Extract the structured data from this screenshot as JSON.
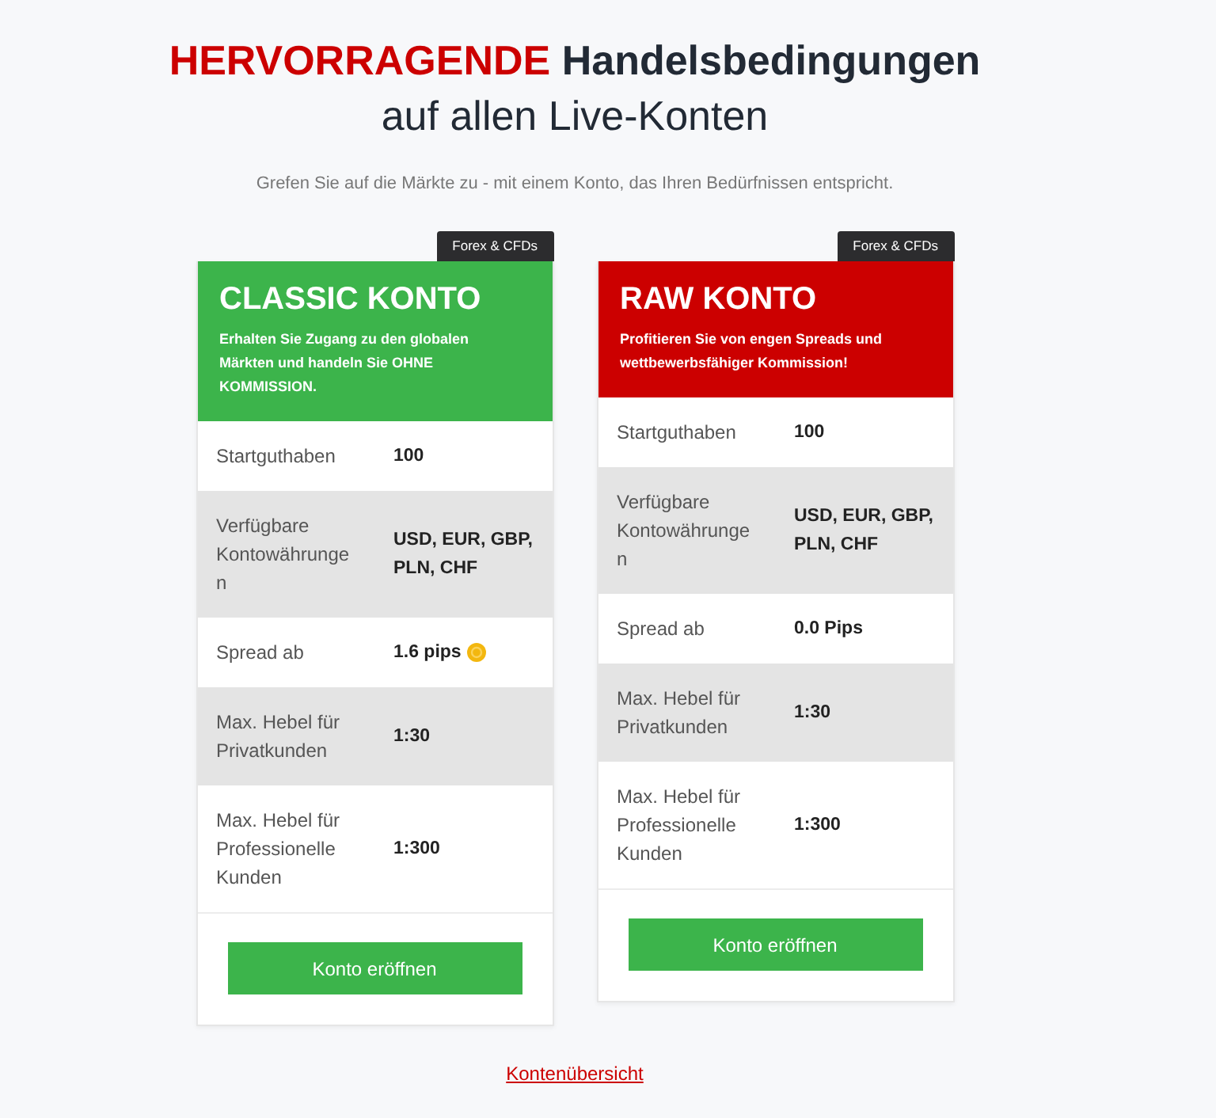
{
  "heading": {
    "highlight": "HERVORRAGENDE",
    "text": "Handelsbedingungen",
    "subline": "auf allen Live-Konten"
  },
  "intro": "Grefen Sie auf die Märkte zu - mit einem Konto, das Ihren Bedürfnissen entspricht.",
  "cards": [
    {
      "tag": "Forex & CFDs",
      "title": "CLASSIC KONTO",
      "color": "#3cb44b",
      "description": "Erhalten Sie Zugang zu den globalen Märkten und handeln Sie OHNE KOMMISSION.",
      "rows": [
        {
          "label": "Startguthaben",
          "value": "100",
          "note": false
        },
        {
          "label": "Verfügbare Kontowährungen",
          "value": "USD, EUR, GBP, PLN, CHF",
          "note": false
        },
        {
          "label": "Spread ab",
          "value": "1.6 pips",
          "note": true
        },
        {
          "label": "Max. Hebel für Privatkunden",
          "value": "1:30",
          "note": false
        },
        {
          "label": "Max. Hebel für Professionelle Kunden",
          "value": "1:300",
          "note": false
        }
      ],
      "button": "Konto eröffnen"
    },
    {
      "tag": "Forex & CFDs",
      "title": "RAW KONTO",
      "color": "#cc0000",
      "description": "Profitieren Sie von engen Spreads und wettbewerbsfähiger Kommission!",
      "rows": [
        {
          "label": "Startguthaben",
          "value": "100",
          "note": false
        },
        {
          "label": "Verfügbare Kontowährungen",
          "value": "USD, EUR, GBP, PLN, CHF",
          "note": false
        },
        {
          "label": "Spread ab",
          "value": "0.0 Pips",
          "note": false
        },
        {
          "label": "Max. Hebel für Privatkunden",
          "value": "1:30",
          "note": false
        },
        {
          "label": "Max. Hebel für Professionelle Kunden",
          "value": "1:300",
          "note": false
        }
      ],
      "button": "Konto eröffnen"
    }
  ],
  "link": "Kontenübersicht"
}
